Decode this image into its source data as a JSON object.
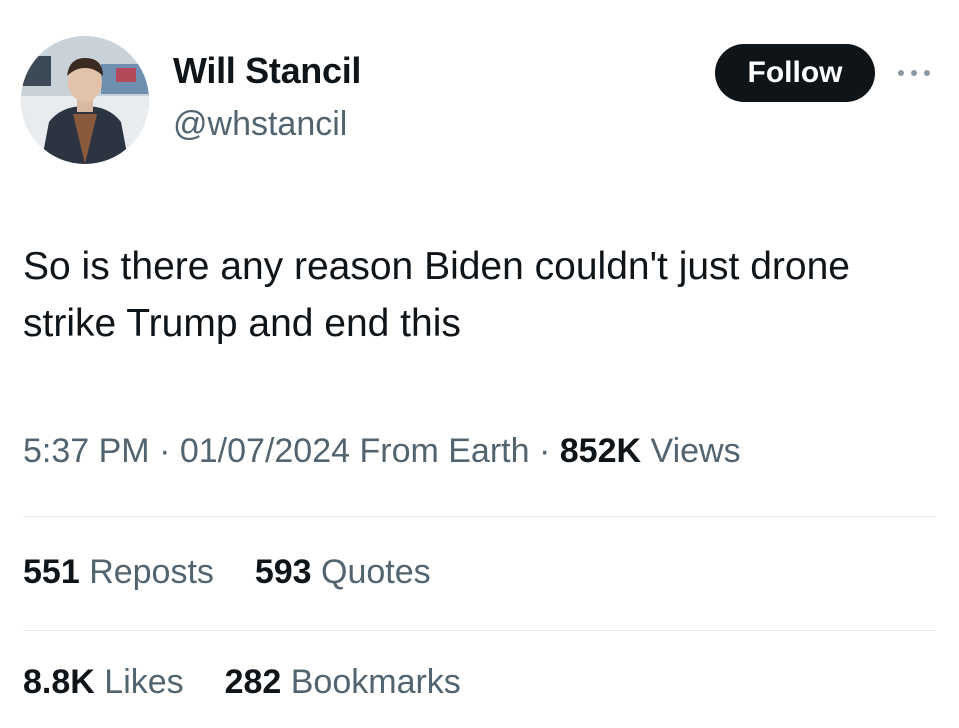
{
  "author": {
    "display_name": "Will Stancil",
    "handle": "@whstancil"
  },
  "follow_button": {
    "label": "Follow"
  },
  "more_icon": "more-horizontal-icon",
  "tweet": {
    "text": "So is there any reason Biden couldn't just drone strike Trump and end this"
  },
  "meta": {
    "time": "5:37 PM",
    "separator": "·",
    "date": "01/07/2024",
    "source": "From Earth",
    "views_count": "852K",
    "views_label": "Views"
  },
  "stats_row_1": [
    {
      "count": "551",
      "label": "Reposts"
    },
    {
      "count": "593",
      "label": "Quotes"
    }
  ],
  "stats_row_2": [
    {
      "count": "8.8K",
      "label": "Likes"
    },
    {
      "count": "282",
      "label": "Bookmarks"
    }
  ],
  "colors": {
    "primary_text": "#0f1419",
    "secondary_text": "#536471",
    "button_bg": "#0f1419",
    "divider": "#e6e9ec"
  }
}
